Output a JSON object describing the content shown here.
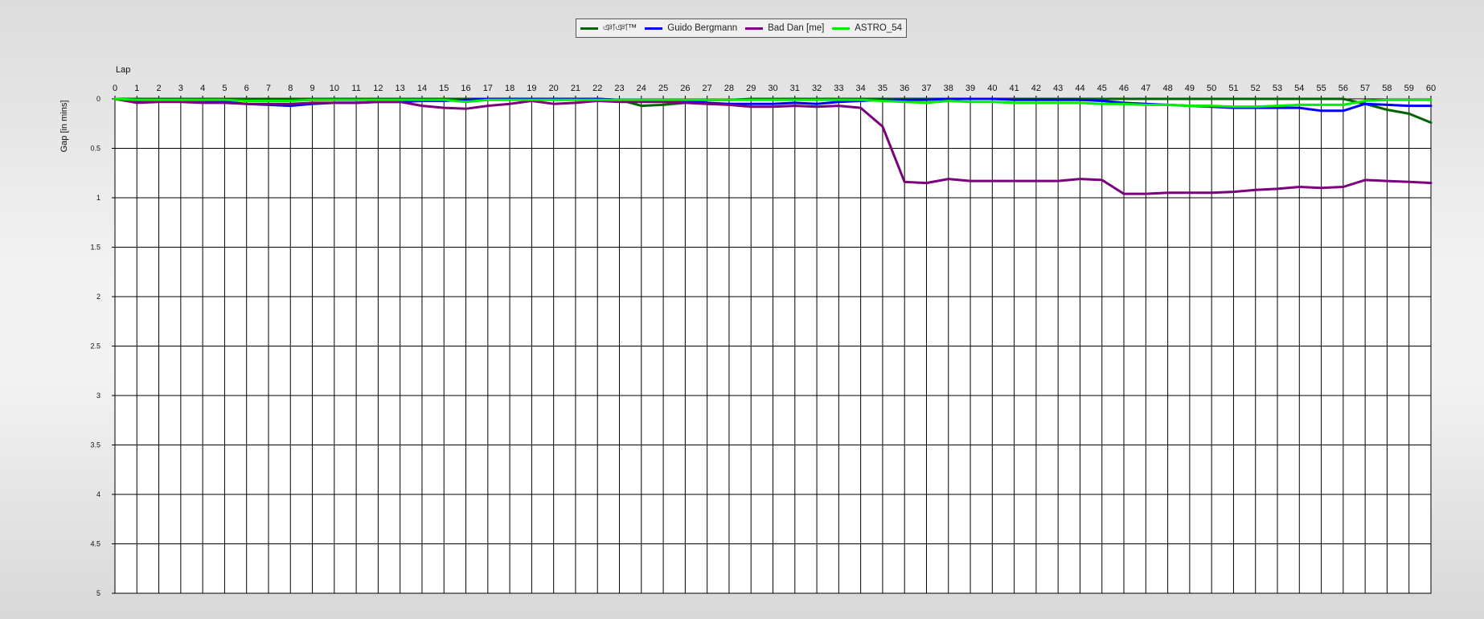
{
  "chart_data": {
    "type": "line",
    "xlabel": "Lap",
    "ylabel": "Gap [in mins]",
    "xlim": [
      0,
      60
    ],
    "ylim": [
      0,
      5
    ],
    "y_inverted": true,
    "x_ticks": [
      0,
      1,
      2,
      3,
      4,
      5,
      6,
      7,
      8,
      9,
      10,
      11,
      12,
      13,
      14,
      15,
      16,
      17,
      18,
      19,
      20,
      21,
      22,
      23,
      24,
      25,
      26,
      27,
      28,
      29,
      30,
      31,
      32,
      33,
      34,
      35,
      36,
      37,
      38,
      39,
      40,
      41,
      42,
      43,
      44,
      45,
      46,
      47,
      48,
      49,
      50,
      51,
      52,
      53,
      54,
      55,
      56,
      57,
      58,
      59,
      60
    ],
    "y_ticks": [
      "0",
      "0.5",
      "1",
      "1.5",
      "2",
      "2.5",
      "3",
      "3.5",
      "4",
      "4.5",
      "5"
    ],
    "grid": true,
    "legend_position": "top-center",
    "x": [
      0,
      1,
      2,
      3,
      4,
      5,
      6,
      7,
      8,
      9,
      10,
      11,
      12,
      13,
      14,
      15,
      16,
      17,
      18,
      19,
      20,
      21,
      22,
      23,
      24,
      25,
      26,
      27,
      28,
      29,
      30,
      31,
      32,
      33,
      34,
      35,
      36,
      37,
      38,
      39,
      40,
      41,
      42,
      43,
      44,
      45,
      46,
      47,
      48,
      49,
      50,
      51,
      52,
      53,
      54,
      55,
      56,
      57,
      58,
      59,
      60
    ],
    "series": [
      {
        "name": "ঞাঞা™",
        "color": "#006400",
        "values": [
          0,
          0,
          0,
          0,
          0,
          0,
          0,
          0,
          0,
          0,
          0,
          0,
          0,
          0,
          0,
          0,
          0,
          0,
          0,
          0,
          0,
          0,
          0,
          0.01,
          0.07,
          0.06,
          0.04,
          0.01,
          0.01,
          0,
          0,
          0,
          0,
          0,
          0,
          0,
          0,
          0,
          0,
          0,
          0,
          0,
          0,
          0,
          0,
          0,
          0,
          0,
          0,
          0,
          0,
          0,
          0,
          0,
          0,
          0,
          0,
          0.05,
          0.11,
          0.15,
          0.24
        ]
      },
      {
        "name": "Guido Bergmann",
        "color": "#0000ff",
        "values": [
          0,
          0.03,
          0.02,
          0.02,
          0.03,
          0.03,
          0.05,
          0.06,
          0.07,
          0.05,
          0.04,
          0.04,
          0.03,
          0.03,
          0.02,
          0.02,
          0.01,
          0,
          0,
          0,
          0,
          0,
          0,
          0.01,
          0.01,
          0.02,
          0.02,
          0.04,
          0.05,
          0.05,
          0.05,
          0.04,
          0.05,
          0.03,
          0.02,
          0.01,
          0.01,
          0.01,
          0,
          0,
          0,
          0.01,
          0.01,
          0.01,
          0.01,
          0.02,
          0.04,
          0.05,
          0.06,
          0.07,
          0.08,
          0.09,
          0.09,
          0.09,
          0.09,
          0.12,
          0.12,
          0.05,
          0.06,
          0.07,
          0.07
        ]
      },
      {
        "name": "Bad Dan [me]",
        "color": "#7b007b",
        "values": [
          0,
          0.04,
          0.03,
          0.03,
          0.04,
          0.04,
          0.05,
          0.05,
          0.05,
          0.04,
          0.04,
          0.04,
          0.03,
          0.03,
          0.07,
          0.09,
          0.1,
          0.07,
          0.05,
          0.02,
          0.05,
          0.04,
          0.02,
          0.03,
          0.03,
          0.03,
          0.04,
          0.05,
          0.06,
          0.08,
          0.08,
          0.07,
          0.08,
          0.07,
          0.09,
          0.28,
          0.84,
          0.85,
          0.81,
          0.83,
          0.83,
          0.83,
          0.83,
          0.83,
          0.81,
          0.82,
          0.96,
          0.96,
          0.95,
          0.95,
          0.95,
          0.94,
          0.92,
          0.91,
          0.89,
          0.9,
          0.89,
          0.82,
          0.83,
          0.84,
          0.85
        ]
      },
      {
        "name": "ASTRO_54",
        "color": "#00ee00",
        "values": [
          0,
          0.01,
          0.01,
          0.01,
          0.01,
          0.01,
          0.02,
          0.02,
          0.02,
          0.01,
          0.01,
          0.01,
          0.01,
          0.01,
          0.01,
          0.01,
          0.03,
          0.01,
          0.01,
          0.01,
          0.01,
          0.01,
          0.01,
          0.01,
          0.01,
          0.01,
          0.01,
          0.01,
          0.01,
          0.01,
          0.01,
          0.01,
          0.01,
          0.01,
          0.01,
          0.02,
          0.03,
          0.04,
          0.02,
          0.03,
          0.03,
          0.04,
          0.04,
          0.04,
          0.04,
          0.05,
          0.05,
          0.06,
          0.06,
          0.07,
          0.07,
          0.08,
          0.08,
          0.07,
          0.06,
          0.06,
          0.06,
          0.02,
          0.01,
          0.01,
          0.01
        ]
      }
    ]
  }
}
